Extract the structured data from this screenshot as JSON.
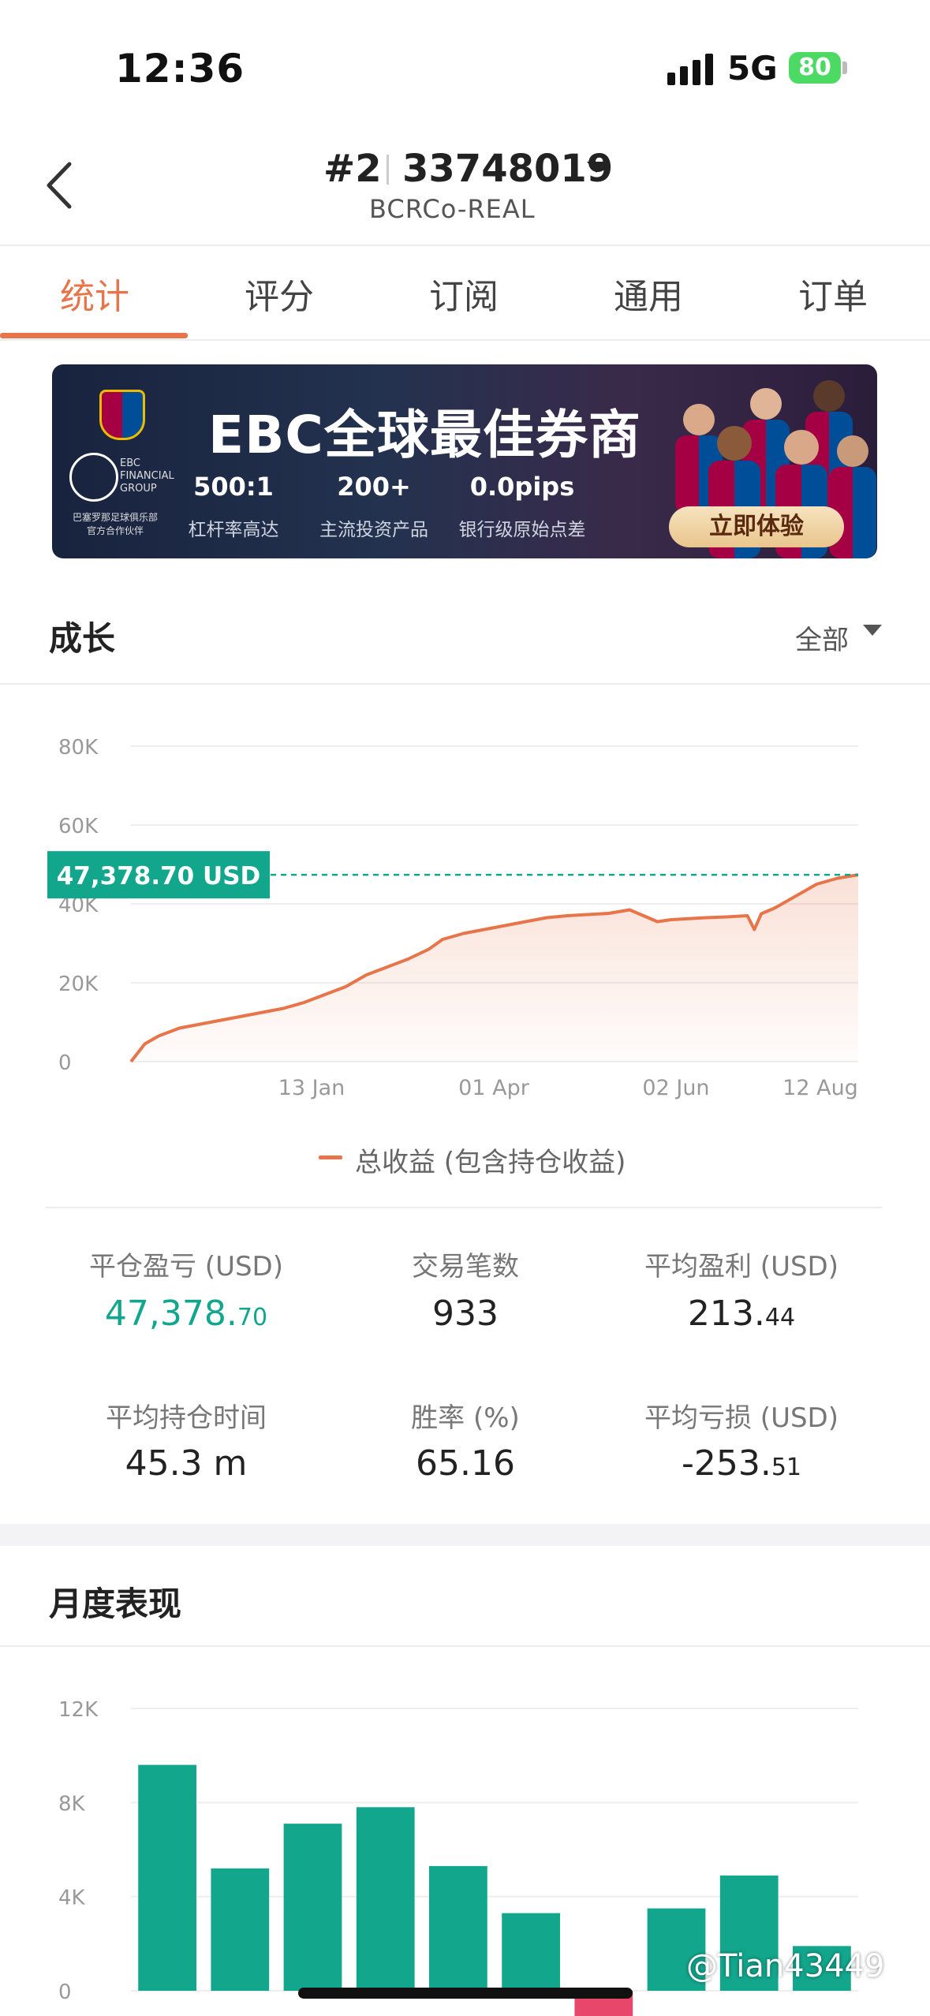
{
  "status_bar": {
    "time": "12:36",
    "network": "5G",
    "battery": "80"
  },
  "header": {
    "rank": "#2",
    "account_number": "33748019",
    "server": "BCRCo-REAL"
  },
  "tabs": [
    {
      "label": "统计",
      "active": true
    },
    {
      "label": "评分",
      "active": false
    },
    {
      "label": "订阅",
      "active": false
    },
    {
      "label": "通用",
      "active": false
    },
    {
      "label": "订单",
      "active": false
    }
  ],
  "banner": {
    "headline": "EBC全球最佳券商",
    "logo_text": "EBC FINANCIAL GROUP",
    "partner_text": "巴塞罗那足球俱乐部 官方合作伙伴",
    "stats": [
      {
        "value": "500:1",
        "label": "杠杆率高达"
      },
      {
        "value": "200+",
        "label": "主流投资产品"
      },
      {
        "value": "0.0pips",
        "label": "银行级原始点差"
      }
    ],
    "cta": "立即体验"
  },
  "growth": {
    "title": "成长",
    "filter": "全部",
    "current_label": "47,378.70 USD",
    "legend": "总收益 (包含持仓收益)"
  },
  "chart_data": [
    {
      "type": "area",
      "title": "",
      "series": [
        {
          "name": "总收益 (包含持仓收益)",
          "points": [
            [
              0,
              0
            ],
            [
              2,
              4500
            ],
            [
              4,
              6500
            ],
            [
              7,
              8500
            ],
            [
              10,
              9500
            ],
            [
              13,
              10500
            ],
            [
              16,
              11500
            ],
            [
              19,
              12500
            ],
            [
              22,
              13500
            ],
            [
              25,
              15000
            ],
            [
              28,
              17000
            ],
            [
              31,
              19000
            ],
            [
              34,
              22000
            ],
            [
              37,
              24000
            ],
            [
              40,
              26000
            ],
            [
              43,
              28500
            ],
            [
              45,
              31000
            ],
            [
              48,
              32500
            ],
            [
              51,
              33500
            ],
            [
              54,
              34500
            ],
            [
              57,
              35500
            ],
            [
              60,
              36500
            ],
            [
              63,
              37000
            ],
            [
              66,
              37300
            ],
            [
              69,
              37600
            ],
            [
              72,
              38500
            ],
            [
              74,
              37000
            ],
            [
              76,
              35500
            ],
            [
              78,
              36000
            ],
            [
              80,
              36200
            ],
            [
              83,
              36500
            ],
            [
              86,
              36700
            ],
            [
              89,
              37000
            ],
            [
              90,
              33500
            ],
            [
              91,
              37500
            ],
            [
              93,
              39000
            ],
            [
              95,
              41000
            ],
            [
              97,
              43000
            ],
            [
              99,
              45000
            ],
            [
              102,
              46500
            ],
            [
              105,
              47378.7
            ]
          ]
        }
      ],
      "x_tick_labels": [
        "13 Jan",
        "01 Apr",
        "02 Jun",
        "12 Aug"
      ],
      "y_ticks": [
        "0",
        "20K",
        "40K",
        "60K",
        "80K"
      ],
      "ylim": [
        0,
        80000
      ],
      "reference_value": 47378.7,
      "colors": {
        "line": "#e8744a",
        "reference": "#12a68c"
      }
    },
    {
      "type": "bar",
      "title": "月度表现",
      "values": [
        9600,
        5200,
        7100,
        7800,
        5300,
        3300,
        -1200,
        3500,
        4900,
        1900
      ],
      "y_ticks": [
        "0",
        "4K",
        "8K",
        "12K"
      ],
      "ylim": [
        0,
        12000
      ],
      "colors": {
        "positive": "#12a68c",
        "negative": "#e8466a"
      }
    }
  ],
  "stats": [
    {
      "label": "平仓盈亏 (USD)",
      "value_main": "47,378.",
      "value_small": "70",
      "green": true
    },
    {
      "label": "交易笔数",
      "value_main": "933",
      "value_small": "",
      "green": false
    },
    {
      "label": "平均盈利 (USD)",
      "value_main": "213.",
      "value_small": "44",
      "green": false
    },
    {
      "label": "平均持仓时间",
      "value_main": "45.3 m",
      "value_small": "",
      "green": false
    },
    {
      "label": "胜率 (%)",
      "value_main": "65.16",
      "value_small": "",
      "green": false
    },
    {
      "label": "平均亏损 (USD)",
      "value_main": "-253.",
      "value_small": "51",
      "green": false
    }
  ],
  "monthly": {
    "title": "月度表现"
  },
  "watermark": "@Tian43449"
}
